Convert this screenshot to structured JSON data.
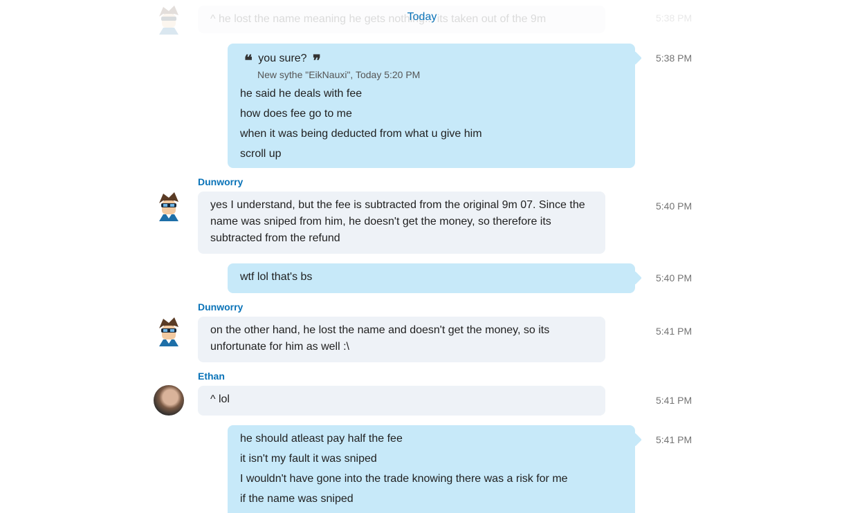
{
  "date_divider": "Today",
  "faded_message": {
    "text": "^ he lost the name meaning he gets nothing... its taken out of the 9m",
    "time": "5:38 PM"
  },
  "messages": [
    {
      "id": "m1",
      "direction": "outgoing",
      "time": "5:38 PM",
      "quote": {
        "text": "you sure?",
        "meta": "New sythe \"EikNauxi\", Today 5:20 PM"
      },
      "lines": [
        "he said he deals with fee",
        "how does fee go to me",
        "when it was being deducted from what u give him",
        "scroll up"
      ]
    },
    {
      "id": "m2",
      "direction": "incoming",
      "sender": "Dunworry",
      "time": "5:40 PM",
      "text": "yes I understand, but the fee is subtracted from the original 9m 07. Since the name was sniped from him, he doesn't get the money, so therefore its subtracted from the refund"
    },
    {
      "id": "m3",
      "direction": "outgoing",
      "time": "5:40 PM",
      "lines": [
        "wtf lol that's bs"
      ]
    },
    {
      "id": "m4",
      "direction": "incoming",
      "sender": "Dunworry",
      "time": "5:41 PM",
      "text": "on the other hand, he lost the name and doesn't get the money, so its unfortunate for him as well :\\"
    },
    {
      "id": "m5",
      "direction": "incoming",
      "sender": "Ethan",
      "time": "5:41 PM",
      "text": "^ lol"
    },
    {
      "id": "m6",
      "direction": "outgoing",
      "time": "5:41 PM",
      "lines": [
        "he should atleast pay half the fee",
        "it isn't my fault it was sniped",
        "I wouldn't have gone into the trade knowing there was a risk for me",
        "if the name was sniped"
      ]
    }
  ],
  "colors": {
    "accent": "#0a73b8",
    "outgoing_bubble": "#c7e9f9",
    "incoming_bubble": "#eef2f7",
    "timestamp": "#737373"
  },
  "icons": {
    "quote_open": "❝",
    "quote_close": "❞"
  }
}
